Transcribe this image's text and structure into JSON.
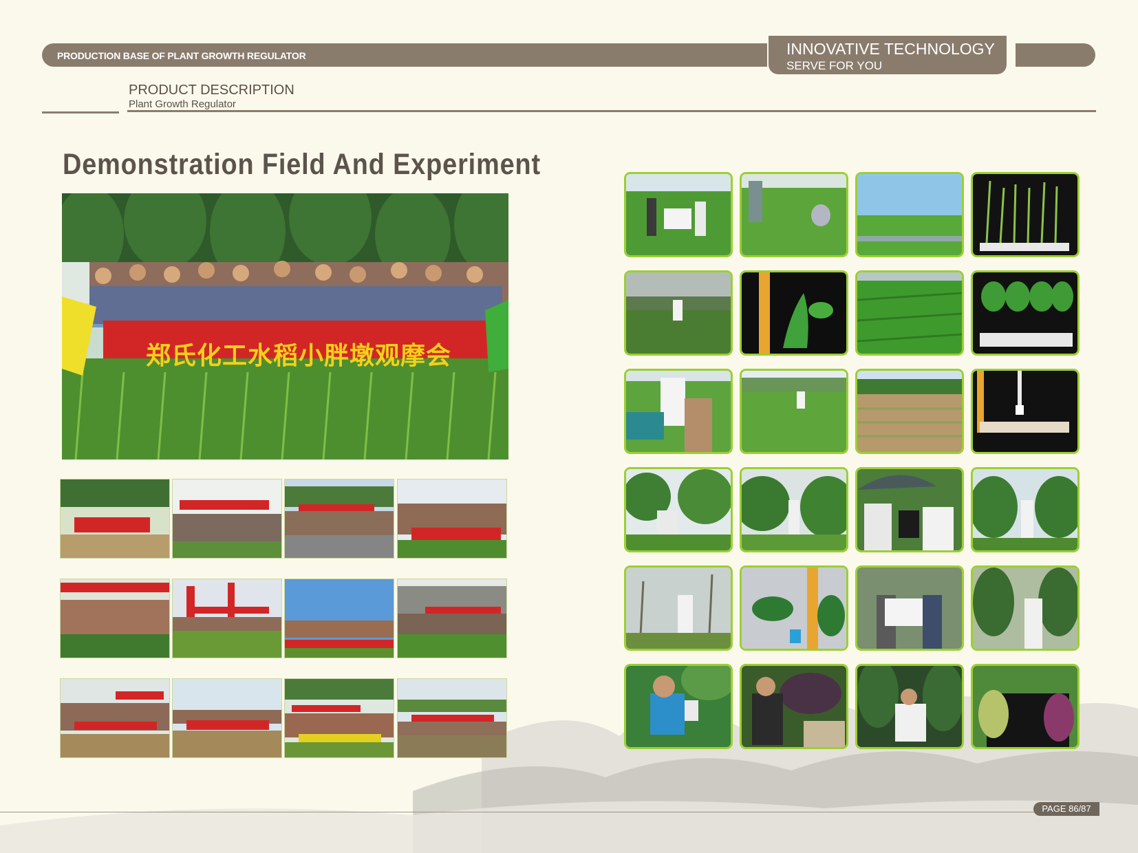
{
  "header": {
    "top_label": "PRODUCTION BASE OF PLANT GROWTH REGULATOR",
    "tech_line1": "INNOVATIVE TECHNOLOGY",
    "tech_line2": "SERVE FOR YOU",
    "desc_title": "PRODUCT DESCRIPTION",
    "desc_sub": "Plant Growth Regulator"
  },
  "section_title": "Demonstration Field And Experiment",
  "main_photo": {
    "banner_text": "郑氏化工水稻小胖墩观摩会"
  },
  "footer": {
    "page": "PAGE 86/87"
  },
  "colors": {
    "bar": "#8a7c6d",
    "background": "#fbf9ec",
    "thumb_border": "#9ccf34",
    "banner_red": "#d22626",
    "banner_yellow": "#f3d11a"
  }
}
